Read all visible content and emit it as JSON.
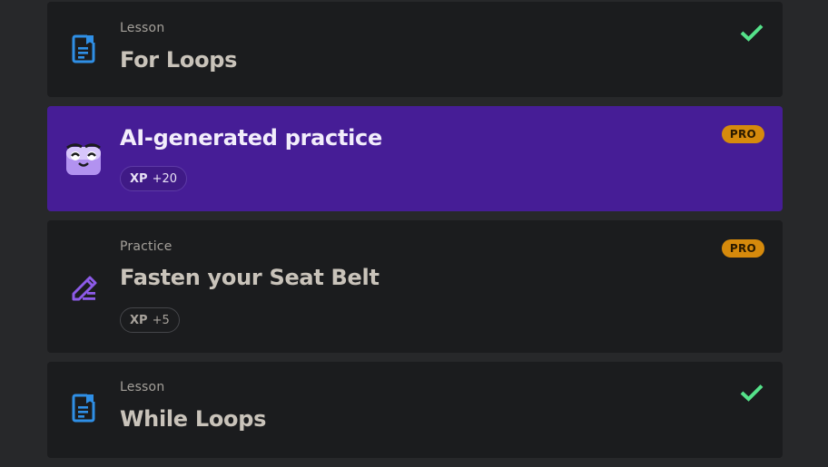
{
  "colors": {
    "background": "#27282a",
    "card": "#1b1c1e",
    "ai_card": "#461d96",
    "lesson_icon": "#2f8fe6",
    "practice_icon": "#8d5be8",
    "check": "#55e28a",
    "pro_badge": "#d68a0c"
  },
  "items": [
    {
      "kind": "Lesson",
      "title": "For Loops",
      "icon": "document-icon",
      "completed": true
    },
    {
      "kind": "",
      "title": "AI-generated practice",
      "icon": "ai-robot-icon",
      "xp_label": "XP",
      "xp_value": "+20",
      "badge": "PRO"
    },
    {
      "kind": "Practice",
      "title": "Fasten your Seat Belt",
      "icon": "pencil-icon",
      "xp_label": "XP",
      "xp_value": "+5",
      "badge": "PRO"
    },
    {
      "kind": "Lesson",
      "title": "While Loops",
      "icon": "document-icon",
      "completed": true
    }
  ]
}
